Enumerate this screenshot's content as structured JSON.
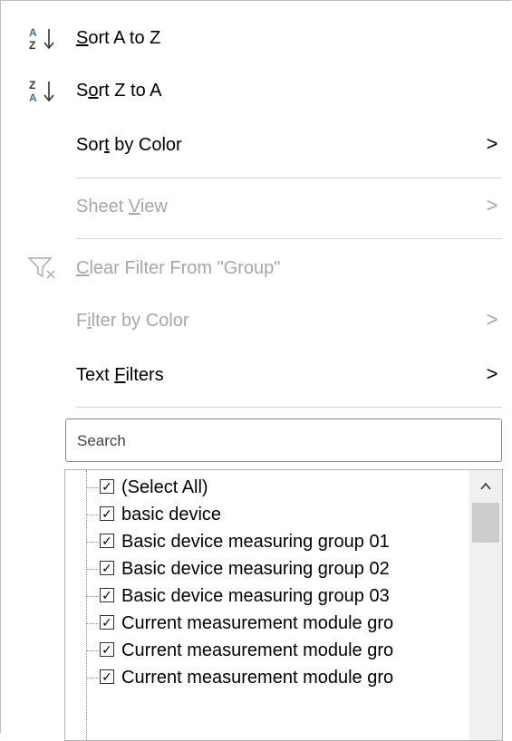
{
  "menu": {
    "sort_az": {
      "label_pre": "",
      "label_u": "S",
      "label_post": "ort A to Z",
      "icon": "sort-ascending-icon"
    },
    "sort_za": {
      "label_pre": "S",
      "label_u": "o",
      "label_post": "rt Z to A",
      "icon": "sort-descending-icon"
    },
    "sort_by_color": {
      "label_pre": "Sor",
      "label_u": "t",
      "label_post": " by Color",
      "chevron": ">"
    },
    "sheet_view": {
      "label_pre": "Sheet ",
      "label_u": "V",
      "label_post": "iew",
      "chevron": ">"
    },
    "clear_filter": {
      "label_pre": "",
      "label_u": "C",
      "label_post": "lear Filter From \"Group\"",
      "icon": "clear-filter-icon"
    },
    "filter_by_color": {
      "label_pre": "F",
      "label_u": "i",
      "label_post": "lter by Color",
      "chevron": ">"
    },
    "text_filters": {
      "label_pre": "Text ",
      "label_u": "F",
      "label_post": "ilters",
      "chevron": ">"
    }
  },
  "search": {
    "placeholder": "Search",
    "value": ""
  },
  "list": {
    "items": [
      {
        "label": "(Select All)",
        "checked": true
      },
      {
        "label": "basic device",
        "checked": true
      },
      {
        "label": "Basic device measuring group 01",
        "checked": true
      },
      {
        "label": "Basic device measuring group 02",
        "checked": true
      },
      {
        "label": "Basic device measuring group 03",
        "checked": true
      },
      {
        "label": "Current measurement module gro",
        "checked": true
      },
      {
        "label": "Current measurement module gro",
        "checked": true
      },
      {
        "label": "Current measurement module gro",
        "checked": true
      }
    ]
  },
  "icons": {
    "scroll_up": "chevron-up-icon",
    "checkbox": "checkmark-icon"
  },
  "colors": {
    "sort_icon_blue": "#2e75b6",
    "disabled_text": "#a7a7a7",
    "separator": "#d2d2d2"
  }
}
